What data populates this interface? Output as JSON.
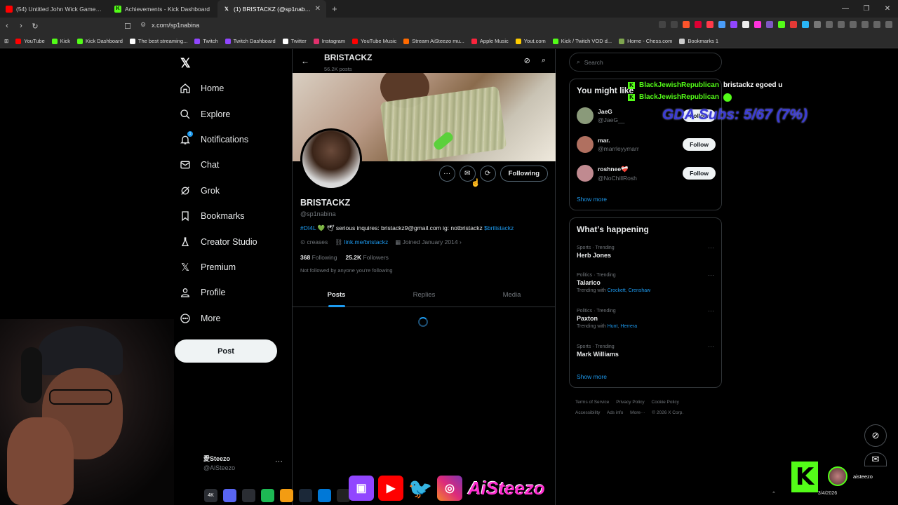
{
  "browser": {
    "tabs": [
      {
        "title": "(54) Untitled John Wick Game - Anna",
        "color": "#ff0000"
      },
      {
        "title": "Achievements - Kick Dashboard",
        "color": "#53fc18"
      },
      {
        "title": "(1) BRISTACKZ (@sp1nabina) / X",
        "color": "#ffffff"
      }
    ],
    "new_tab": "+",
    "url": "x.com/sp1nabina",
    "bookmarks": [
      {
        "label": "YouTube",
        "color": "#ff0000"
      },
      {
        "label": "Kick",
        "color": "#53fc18"
      },
      {
        "label": "Kick Dashboard",
        "color": "#53fc18"
      },
      {
        "label": "The best streaming...",
        "color": "#ffffff"
      },
      {
        "label": "Twitch",
        "color": "#9146ff"
      },
      {
        "label": "Twitch Dashboard",
        "color": "#9146ff"
      },
      {
        "label": "Twitter",
        "color": "#ffffff"
      },
      {
        "label": "Instagram",
        "color": "#e1306c"
      },
      {
        "label": "YouTube Music",
        "color": "#ff0000"
      },
      {
        "label": "Stream AiSteezo mu...",
        "color": "#ff6a00"
      },
      {
        "label": "Apple Music",
        "color": "#fa243c"
      },
      {
        "label": "Yout.com",
        "color": "#ffcc00"
      },
      {
        "label": "Kick / Twitch VOD d...",
        "color": "#53fc18"
      },
      {
        "label": "Home - Chess.com",
        "color": "#7fa650"
      },
      {
        "label": "Bookmarks 1",
        "color": "#cccccc"
      }
    ]
  },
  "nav": {
    "items": [
      {
        "label": "Home",
        "icon": "home-icon"
      },
      {
        "label": "Explore",
        "icon": "search-icon"
      },
      {
        "label": "Notifications",
        "icon": "bell-icon",
        "badge": "1"
      },
      {
        "label": "Chat",
        "icon": "mail-icon"
      },
      {
        "label": "Grok",
        "icon": "grok-icon"
      },
      {
        "label": "Bookmarks",
        "icon": "bookmark-icon"
      },
      {
        "label": "Creator Studio",
        "icon": "flask-icon"
      },
      {
        "label": "Premium",
        "icon": "x-icon"
      },
      {
        "label": "Profile",
        "icon": "person-icon"
      },
      {
        "label": "More",
        "icon": "more-circle-icon"
      }
    ],
    "post_label": "Post",
    "account": {
      "name": "愛Steezo",
      "handle": "@AiSteezo"
    }
  },
  "profile": {
    "header_name": "BRISTACKZ",
    "post_count": "56.2K posts",
    "name": "BRISTACKZ",
    "handle": "@sp1nabina",
    "bio_tag": "#DI4L",
    "bio_text": "💚 🕊 serious inquires: bristackz9@gmail.com ig: notbristackz",
    "bio_cashtag": "$brilistackz",
    "location": "creases",
    "link": "link.me/bristackz",
    "joined": "Joined January 2014",
    "following_count": "368",
    "following_label": "Following",
    "followers_count": "25.2K",
    "followers_label": "Followers",
    "not_followed": "Not followed by anyone you're following",
    "following_button": "Following",
    "tabs": [
      "Posts",
      "Replies",
      "Media"
    ]
  },
  "sidebar": {
    "search_placeholder": "Search",
    "wtf_title": "You might like",
    "suggestions": [
      {
        "name": "JaeG",
        "handle": "@JaeG__",
        "button": "Follow",
        "color": "#8a9a7a"
      },
      {
        "name": "mar.",
        "handle": "@marrleyymarr",
        "button": "Follow",
        "color": "#b07060"
      },
      {
        "name": "roshnee❤️‍🩹",
        "handle": "@NoChillRosh",
        "button": "Follow",
        "color": "#c08a90"
      }
    ],
    "show_more": "Show more",
    "happening_title": "What’s happening",
    "trends": [
      {
        "category": "Sports · Trending",
        "topic": "Herb Jones",
        "with_label": "",
        "with": []
      },
      {
        "category": "Politics · Trending",
        "topic": "Talarico",
        "with_label": "Trending with",
        "with": [
          "Crockett",
          "Crenshaw"
        ]
      },
      {
        "category": "Politics · Trending",
        "topic": "Paxton",
        "with_label": "Trending with",
        "with": [
          "Hunt",
          "Herrera"
        ]
      },
      {
        "category": "Sports · Trending",
        "topic": "Mark Williams",
        "with_label": "",
        "with": []
      }
    ],
    "footer": [
      "Terms of Service",
      "Privacy Policy",
      "Cookie Policy",
      "Accessibility",
      "Ads info",
      "More···",
      "© 2026 X Corp."
    ]
  },
  "overlay": {
    "chat": [
      {
        "user": "BlackJewishRepublican",
        "message": "bristackz egoed u"
      },
      {
        "user": "BlackJewishRepublican",
        "message": ""
      }
    ],
    "gda": "GDA Subs: 5/67 (7%)",
    "brand": "AiSteezo",
    "kick_username": "aisteezo",
    "date": "3/4/2026"
  }
}
